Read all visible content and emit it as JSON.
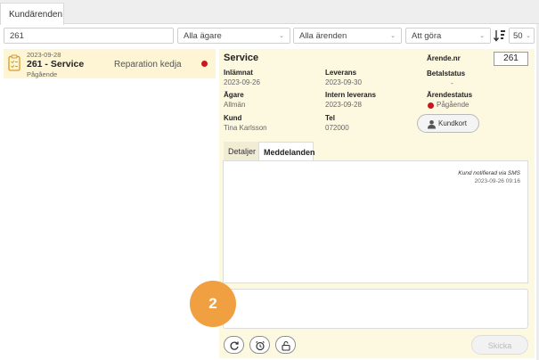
{
  "app": {
    "tab_title": "Kundärenden"
  },
  "filters": {
    "search_value": "261",
    "owner_select": "Alla ägare",
    "cases_select": "Alla ärenden",
    "todo_select": "Att göra",
    "page_size_select": "50",
    "caret": "⌄"
  },
  "list": {
    "items": [
      {
        "date": "2023-09-28",
        "title": "261 - Service",
        "status": "Pågående",
        "description": "Reparation kedja",
        "status_color": "#c8181e"
      }
    ]
  },
  "detail": {
    "title": "Service",
    "submitted_label": "Inlämnat",
    "submitted_value": "2023-09-26",
    "delivery_label": "Leverans",
    "delivery_value": "2023-09-30",
    "owner_label": "Ägare",
    "owner_value": "Allmän",
    "internal_delivery_label": "Intern leverans",
    "internal_delivery_value": "2023-09-28",
    "customer_label": "Kund",
    "customer_value": "Tina Karlsson",
    "phone_label": "Tel",
    "phone_value": "072000",
    "case_nr_label": "Ärende.nr",
    "case_nr_value": "261",
    "payment_status_label": "Betalstatus",
    "payment_status_value": "-",
    "case_status_label": "Ärendestatus",
    "case_status_value": "Pågående",
    "customer_card_button": "Kundkort"
  },
  "tabs": {
    "details": "Detaljer",
    "messages": "Meddelanden"
  },
  "messages": [
    {
      "text": "Kund notifierad via SMS",
      "time": "2023-09-26 09:16"
    }
  ],
  "compose": {
    "step_badge": "2",
    "send_button": "Skicka"
  },
  "icons": {
    "action_1": "refresh-icon",
    "action_2": "alarm-clock-icon",
    "action_3": "unlock-icon",
    "sort": "sort-descending-icon",
    "clipboard": "clipboard-icon",
    "person": "person-card-icon"
  },
  "colors": {
    "accent_bg": "#fdf8e0",
    "selected_bg": "#fdf5d4",
    "status_red": "#c8181e",
    "badge_orange": "#f0a040"
  }
}
